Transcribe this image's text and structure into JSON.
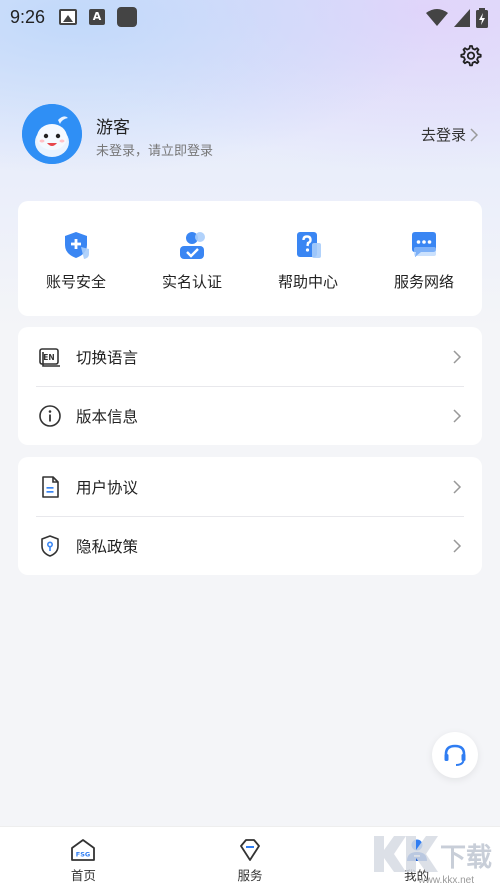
{
  "status_bar": {
    "time": "9:26",
    "a_icon": "A"
  },
  "profile": {
    "name": "游客",
    "subtitle": "未登录，请立即登录",
    "login_label": "去登录"
  },
  "quick_actions": [
    {
      "label": "账号安全",
      "icon": "shield-plus-icon"
    },
    {
      "label": "实名认证",
      "icon": "user-verify-icon"
    },
    {
      "label": "帮助中心",
      "icon": "help-doc-icon"
    },
    {
      "label": "服务网络",
      "icon": "chat-bubble-icon"
    }
  ],
  "settings_group_1": [
    {
      "label": "切换语言",
      "icon": "language-en-icon"
    },
    {
      "label": "版本信息",
      "icon": "info-circle-icon"
    }
  ],
  "settings_group_2": [
    {
      "label": "用户协议",
      "icon": "document-icon"
    },
    {
      "label": "隐私政策",
      "icon": "privacy-shield-icon"
    }
  ],
  "bottom_nav": {
    "home": "首页",
    "service": "服务",
    "mine": "我的",
    "home_logo_text": "FSG"
  },
  "watermark": {
    "text": "www.kkx.net",
    "logo_text": "下载"
  },
  "colors": {
    "accent": "#2f7df2",
    "background": "#f4f5f8"
  }
}
